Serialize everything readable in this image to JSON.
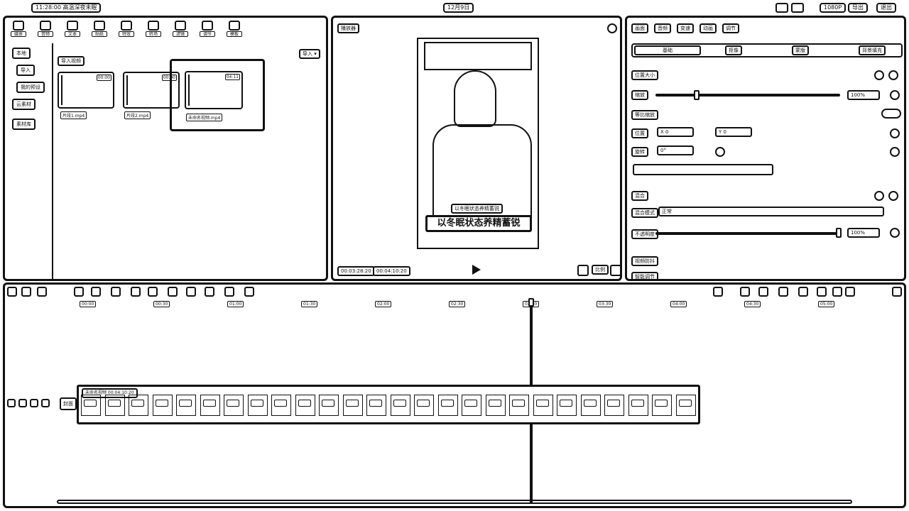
{
  "titlebar": {
    "project": "11:28:00 高温深夜未眠",
    "date": "12月9日",
    "right_pill": "1080P",
    "export_label": "导出",
    "window_label": "退出"
  },
  "media_toolbar": [
    {
      "label": "媒体",
      "icon": "media-icon"
    },
    {
      "label": "音频",
      "icon": "audio-icon"
    },
    {
      "label": "文本",
      "icon": "text-icon"
    },
    {
      "label": "贴纸",
      "icon": "sticker-icon"
    },
    {
      "label": "特效",
      "icon": "effects-icon"
    },
    {
      "label": "转场",
      "icon": "transition-icon"
    },
    {
      "label": "滤镜",
      "icon": "filter-icon"
    },
    {
      "label": "调节",
      "icon": "adjust-icon"
    },
    {
      "label": "模板",
      "icon": "template-icon"
    }
  ],
  "media_sidebar": [
    {
      "label": "本地"
    },
    {
      "label": "导入"
    },
    {
      "label": "我的预设"
    },
    {
      "label": "云素材"
    },
    {
      "label": "素材库"
    }
  ],
  "media_section": {
    "title": "导入视频",
    "import_button": "导入 ▾"
  },
  "media_items": [
    {
      "caption": "片段1.mp4",
      "duration": "00:00"
    },
    {
      "caption": "片段2.mp4",
      "duration": "00:00"
    },
    {
      "caption": "未命名视频.mp4",
      "duration": "04:11"
    }
  ],
  "player": {
    "title": "播放器",
    "subtitle_small": "以冬眠状态养精蓄锐",
    "subtitle_large": "以冬眠状态养精蓄锐",
    "current_time": "00:03:28:20",
    "total_time": "00:04:10:20",
    "ratio": "比例"
  },
  "inspector": {
    "tabs": [
      "画面",
      "音频",
      "变速",
      "动画",
      "调节"
    ],
    "subtabs": [
      "基础",
      "抠像",
      "蒙版",
      "背景填充"
    ],
    "position_size": "位置大小",
    "scale_label": "缩放",
    "scale_value": "100%",
    "uniform_scale": "等比缩放",
    "pos_label": "位置",
    "x_label": "X",
    "x_value": "0",
    "y_label": "Y",
    "y_value": "0",
    "rotate_label": "旋转",
    "rotate_value": "0°",
    "blend_label": "混合",
    "blend_mode_label": "混合模式",
    "blend_mode_value": "正常",
    "opacity_label": "不透明度",
    "opacity_value": "100%",
    "stabilize_label": "视频防抖",
    "bottom_hint": "智能调节"
  },
  "timeline": {
    "ruler": [
      "00:00",
      "00:30",
      "01:00",
      "01:30",
      "02:00",
      "02:30",
      "03:00",
      "03:30",
      "04:00",
      "04:30",
      "05:00"
    ],
    "clip_title": "未命名视频  00:04:10:20",
    "cover_label": "封面"
  }
}
